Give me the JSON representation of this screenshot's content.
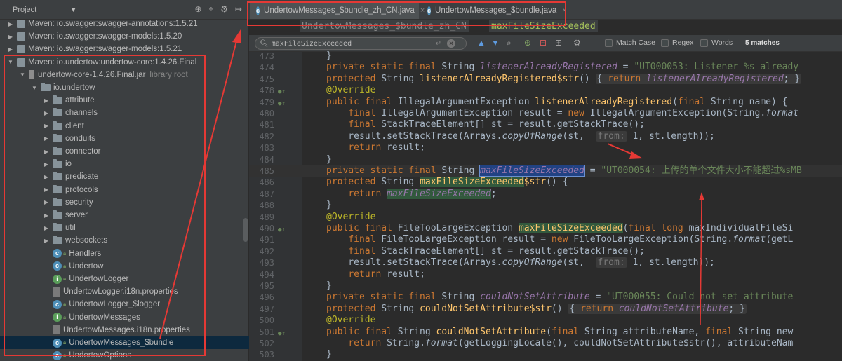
{
  "project": {
    "title": "Project",
    "dropdown_arrow": "▼",
    "tools": [
      "⊕",
      "÷",
      "⚙",
      "↦"
    ],
    "tree": [
      {
        "kind": "maven",
        "label": "Maven: io.swagger:swagger-annotations:1.5.21",
        "expanded": false,
        "indent": 0
      },
      {
        "kind": "maven",
        "label": "Maven: io.swagger:swagger-models:1.5.20",
        "expanded": false,
        "indent": 0
      },
      {
        "kind": "maven",
        "label": "Maven: io.swagger:swagger-models:1.5.21",
        "expanded": false,
        "indent": 0
      },
      {
        "kind": "maven",
        "label": "Maven: io.undertow:undertow-core:1.4.26.Final",
        "expanded": true,
        "indent": 0
      },
      {
        "kind": "jar",
        "label": "undertow-core-1.4.26.Final.jar",
        "suffix": "library root",
        "expanded": true,
        "indent": 1
      },
      {
        "kind": "package",
        "label": "io.undertow",
        "expanded": true,
        "indent": 2
      },
      {
        "kind": "package",
        "label": "attribute",
        "expanded": false,
        "indent": 3
      },
      {
        "kind": "package",
        "label": "channels",
        "expanded": false,
        "indent": 3
      },
      {
        "kind": "package",
        "label": "client",
        "expanded": false,
        "indent": 3
      },
      {
        "kind": "package",
        "label": "conduits",
        "expanded": false,
        "indent": 3
      },
      {
        "kind": "package",
        "label": "connector",
        "expanded": false,
        "indent": 3
      },
      {
        "kind": "package",
        "label": "io",
        "expanded": false,
        "indent": 3
      },
      {
        "kind": "package",
        "label": "predicate",
        "expanded": false,
        "indent": 3
      },
      {
        "kind": "package",
        "label": "protocols",
        "expanded": false,
        "indent": 3
      },
      {
        "kind": "package",
        "label": "security",
        "expanded": false,
        "indent": 3
      },
      {
        "kind": "package",
        "label": "server",
        "expanded": false,
        "indent": 3
      },
      {
        "kind": "package",
        "label": "util",
        "expanded": false,
        "indent": 3
      },
      {
        "kind": "package",
        "label": "websockets",
        "expanded": false,
        "indent": 3
      },
      {
        "kind": "class",
        "label": "Handlers",
        "indent": 3
      },
      {
        "kind": "class",
        "label": "Undertow",
        "indent": 3
      },
      {
        "kind": "class-green",
        "label": "UndertowLogger",
        "indent": 3
      },
      {
        "kind": "props",
        "label": "UndertowLogger.i18n.properties",
        "indent": 3
      },
      {
        "kind": "class",
        "label": "UndertowLogger_$logger",
        "indent": 3
      },
      {
        "kind": "class-green",
        "label": "UndertowMessages",
        "indent": 3
      },
      {
        "kind": "props",
        "label": "UndertowMessages.i18n.properties",
        "indent": 3
      },
      {
        "kind": "class",
        "label": "UndertowMessages_$bundle",
        "indent": 3,
        "selected": true
      },
      {
        "kind": "class",
        "label": "UndertowOptions",
        "indent": 3
      }
    ]
  },
  "editor": {
    "tabs": [
      {
        "label": "UndertowMessages_$bundle_zh_CN.java",
        "active": true,
        "close": "×"
      },
      {
        "label": "UndertowMessages_$bundle.java",
        "active": false,
        "close": "×"
      }
    ],
    "breadcrumb": [
      "UndertowMessages_$bundle_zh_CN",
      "maxFileSizeExceeded"
    ],
    "find": {
      "value": "maxFileSizeExceeded",
      "return_glyph": "↵",
      "clear_glyph": "✕",
      "match_case": "Match Case",
      "regex": "Regex",
      "words": "Words",
      "matches": "5 matches"
    },
    "lines": [
      {
        "n": "473",
        "html": "<span class='w'>}</span>"
      },
      {
        "n": "474",
        "html": "<span class='kw'>private static final </span><span class='w'>String </span><span class='fld'>listenerAlreadyRegistered</span><span class='w'> = </span><span class='st'>\"UT000053: Listener %s already</span>"
      },
      {
        "n": "475",
        "html": "<span class='kw'>protected </span><span class='w'>String </span><span class='fn'>listenerAlreadyRegistered$str</span><span class='w'>() </span><span class='fold-in'><span class='w'>{ </span><span class='kw'>return </span><span class='fld'>listenerAlreadyRegistered</span><span class='w'>; }</span></span>"
      },
      {
        "n": "478",
        "html": "<span class='an'>@Override</span>",
        "gicon": true
      },
      {
        "n": "479",
        "html": "<span class='kw'>public final </span><span class='w'>IllegalArgumentException </span><span class='fn'>listenerAlreadyRegistered</span><span class='w'>(</span><span class='kw'>final </span><span class='w'>String name) {</span>",
        "gicon": true
      },
      {
        "n": "480",
        "html": "<span class='w'>    </span><span class='kw'>final </span><span class='w'>IllegalArgumentException result = </span><span class='kw'>new </span><span class='w'>IllegalArgumentException(String.</span><span class='w it'>format</span>"
      },
      {
        "n": "481",
        "html": "<span class='w'>    </span><span class='kw'>final </span><span class='w'>StackTraceElement[] st = result.getStackTrace();</span>"
      },
      {
        "n": "482",
        "html": "<span class='w'>    result.setStackTrace(Arrays.</span><span class='w it'>copyOfRange</span><span class='w'>(st,  </span><span class='hint'>from:</span><span class='w'> 1, st.length));</span>"
      },
      {
        "n": "483",
        "html": "<span class='w'>    </span><span class='kw'>return </span><span class='w'>result;</span>"
      },
      {
        "n": "484",
        "html": "<span class='w'>}</span>"
      },
      {
        "n": "485",
        "html": "<span class='kw'>private static final </span><span class='w'>String </span><span class='fld hlsel'>maxFileSizeExceeded</span><span class='w'> = </span><span class='st'>\"UT000054: 上传的单个文件大小不能超过%sMB</span>",
        "cur": true
      },
      {
        "n": "486",
        "html": "<span class='kw'>protected </span><span class='w'>String </span><span class='fn hl'>maxFileSizeExceeded</span><span class='fn'>$str</span><span class='w'>() {</span>"
      },
      {
        "n": "487",
        "html": "<span class='w'>    </span><span class='kw'>return </span><span class='fld hl'>maxFileSizeExceeded</span><span class='w'>;</span>"
      },
      {
        "n": "488",
        "html": "<span class='w'>}</span>"
      },
      {
        "n": "489",
        "html": "<span class='an'>@Override</span>"
      },
      {
        "n": "490",
        "html": "<span class='kw'>public final </span><span class='w'>FileTooLargeException </span><span class='fn hl'>maxFileSizeExceeded</span><span class='w'>(</span><span class='kw'>final long </span><span class='w'>maxIndividualFileSi</span>",
        "gicon": true
      },
      {
        "n": "491",
        "html": "<span class='w'>    </span><span class='kw'>final </span><span class='w'>FileTooLargeException result = </span><span class='kw'>new </span><span class='w'>FileTooLargeException(String.</span><span class='w it'>format</span><span class='w'>(getL</span>"
      },
      {
        "n": "492",
        "html": "<span class='w'>    </span><span class='kw'>final </span><span class='w'>StackTraceElement[] st = result.getStackTrace();</span>"
      },
      {
        "n": "493",
        "html": "<span class='w'>    result.setStackTrace(Arrays.</span><span class='w it'>copyOfRange</span><span class='w'>(st,  </span><span class='hint'>from:</span><span class='w'> 1, st.length));</span>"
      },
      {
        "n": "494",
        "html": "<span class='w'>    </span><span class='kw'>return </span><span class='w'>result;</span>"
      },
      {
        "n": "495",
        "html": "<span class='w'>}</span>"
      },
      {
        "n": "496",
        "html": "<span class='kw'>private static final </span><span class='w'>String </span><span class='fld'>couldNotSetAttribute</span><span class='w'> = </span><span class='st'>\"UT000055: Could not set attribute</span>"
      },
      {
        "n": "497",
        "html": "<span class='kw'>protected </span><span class='w'>String </span><span class='fn'>couldNotSetAttribute$str</span><span class='w'>() </span><span class='fold-in'><span class='w'>{ </span><span class='kw'>return </span><span class='fld'>couldNotSetAttribute</span><span class='w'>; }</span></span>"
      },
      {
        "n": "500",
        "html": "<span class='an'>@Override</span>"
      },
      {
        "n": "501",
        "html": "<span class='kw'>public final </span><span class='w'>String </span><span class='fn'>couldNotSetAttribute</span><span class='w'>(</span><span class='kw'>final </span><span class='w'>String attributeName, </span><span class='kw'>final </span><span class='w'>String new</span>",
        "gicon": true
      },
      {
        "n": "502",
        "html": "<span class='w'>    </span><span class='kw'>return </span><span class='w'>String.</span><span class='w it'>format</span><span class='w'>(getLoggingLocale(), couldNotSetAttribute$str(), attributeNam</span>"
      },
      {
        "n": "503",
        "html": "<span class='w'>}</span>"
      }
    ]
  },
  "colors": {
    "annotation_red": "#e53935",
    "match_highlight": "#32593d",
    "selection": "#214283"
  }
}
